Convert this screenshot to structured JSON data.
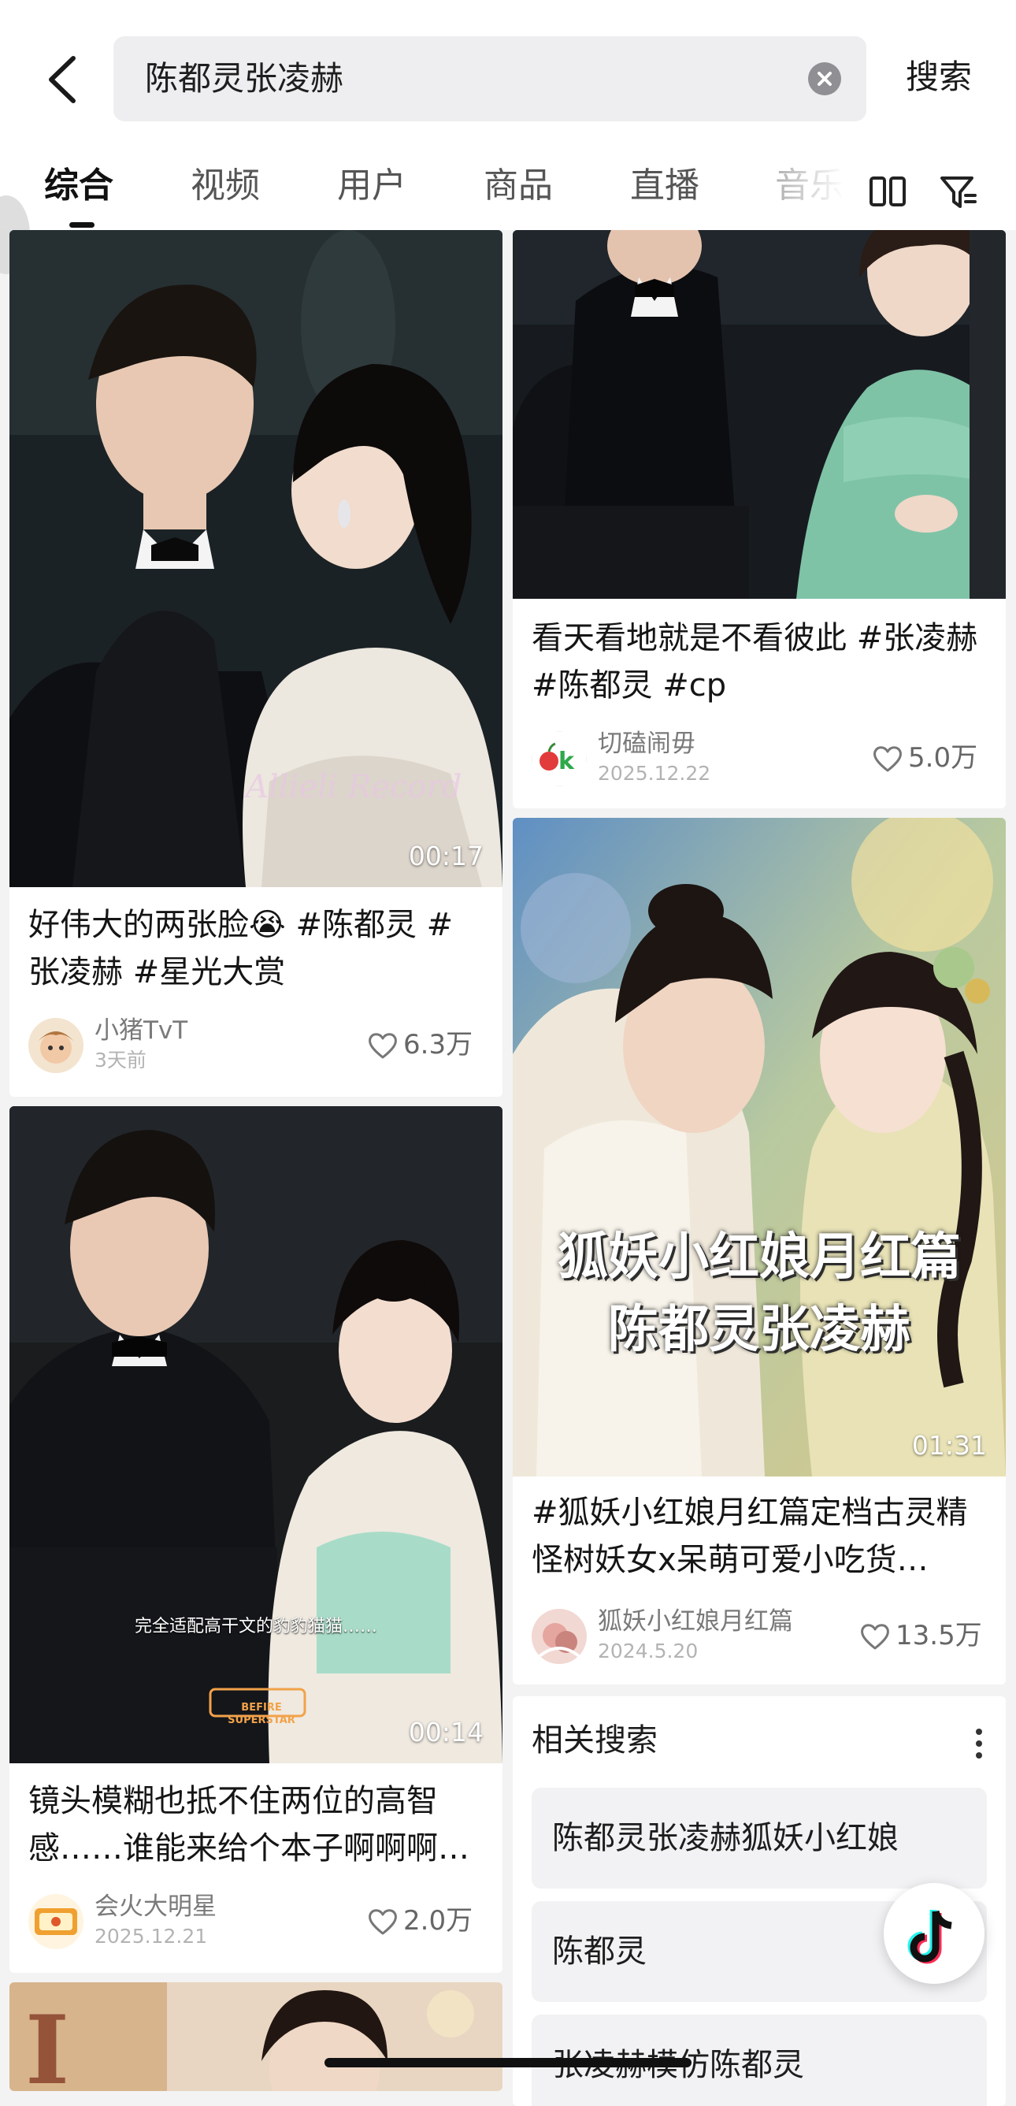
{
  "search": {
    "query": "陈都灵张凌赫",
    "submit_label": "搜索"
  },
  "tabs": [
    "综合",
    "视频",
    "用户",
    "商品",
    "直播",
    "音乐"
  ],
  "active_tab": "综合",
  "icons": {
    "back": "back-arrow-icon",
    "clear": "clear-icon",
    "layout": "two-column-layout-icon",
    "filter": "filter-icon",
    "like": "heart-icon",
    "more": "more-dots-icon",
    "douyin": "douyin-logo-icon"
  },
  "cards": [
    {
      "duration": "00:17",
      "title": "好伟大的两张脸😭 #陈都灵 #张凌赫 #星光大赏",
      "author": "小猪TvT",
      "date": "3天前",
      "likes": "6.3万"
    },
    {
      "title": "看天看地就是不看彼此 #张凌赫 #陈都灵 #cp",
      "author": "切磕闹毋",
      "date": "2025.12.22",
      "likes": "5.0万"
    },
    {
      "duration": "00:14",
      "caption": "完全适配高干文的豹豹猫猫……",
      "watermark": "BEFIRE SUPERSTAR",
      "title": "镜头模糊也抵不住两位的高智感……谁能来给个本子啊啊啊…",
      "author": "会火大明星",
      "date": "2025.12.21",
      "likes": "2.0万"
    },
    {
      "duration": "01:31",
      "overlay_line1": "狐妖小红娘月红篇",
      "overlay_line2": "陈都灵张凌赫",
      "title": "#狐妖小红娘月红篇定档古灵精怪树妖女x呆萌可爱小吃货…",
      "author": "狐妖小红娘月红篇",
      "date": "2024.5.20",
      "likes": "13.5万"
    }
  ],
  "related": {
    "title": "相关搜索",
    "items": [
      "陈都灵张凌赫狐妖小红娘",
      "陈都灵",
      "张凌赫模仿陈都灵"
    ]
  },
  "colors": {
    "background": "#f3f3f3",
    "card": "#ffffff",
    "search_box": "#eeeef0",
    "text_primary": "#151515",
    "text_secondary": "#7a7a7a"
  }
}
